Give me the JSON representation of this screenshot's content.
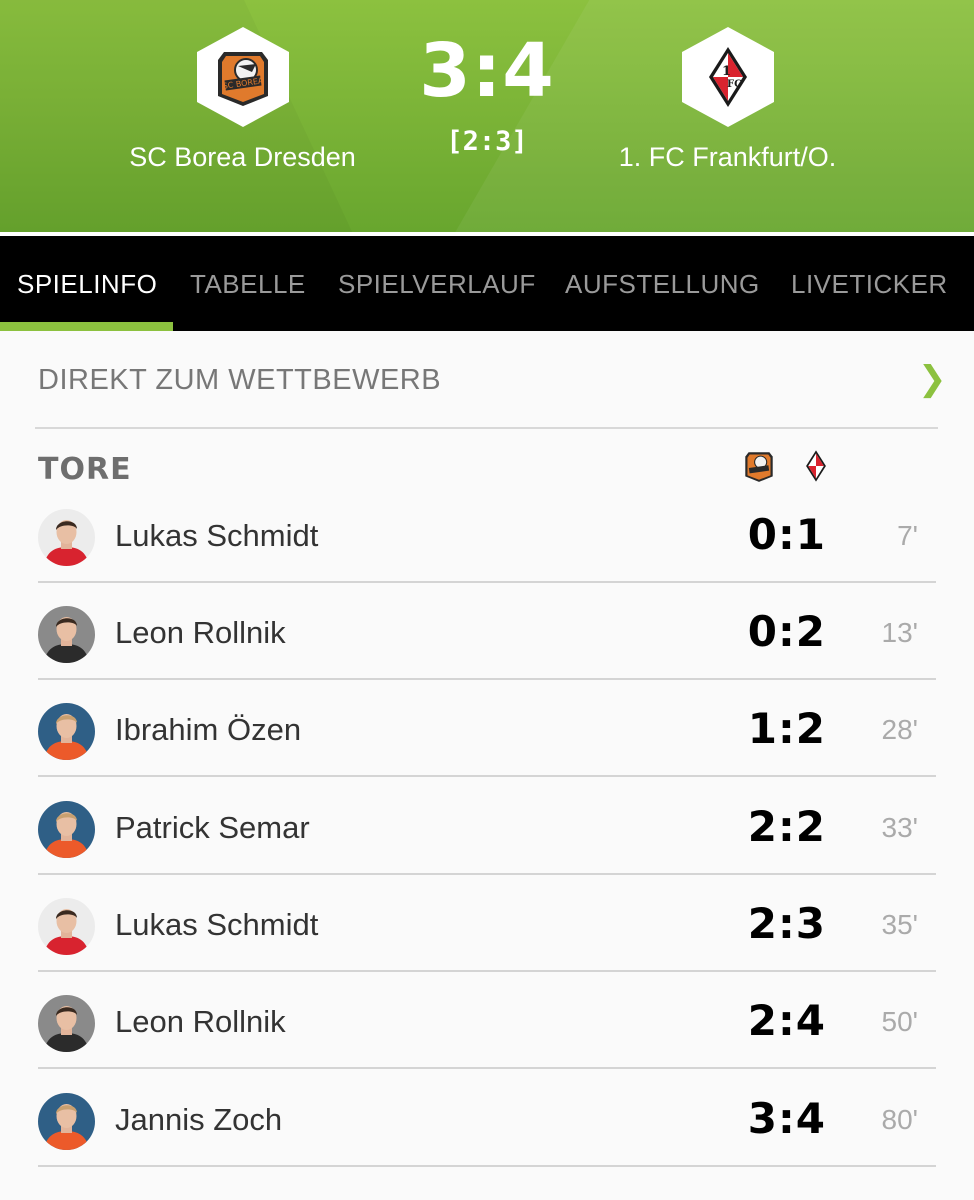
{
  "match": {
    "home_team": "SC Borea Dresden",
    "away_team": "1. FC Frankfurt/O.",
    "score": "3:4",
    "halftime": "[2:3]",
    "home_logo_icon": "sc-borea-crest-icon",
    "away_logo_icon": "fc-frankfurt-crest-icon",
    "colors": {
      "header_green": "#79b236",
      "accent_green": "#8cc13f"
    }
  },
  "tabs": [
    {
      "label": "SPIELINFO",
      "active": true
    },
    {
      "label": "TABELLE",
      "active": false
    },
    {
      "label": "SPIELVERLAUF",
      "active": false
    },
    {
      "label": "AUFSTELLUNG",
      "active": false
    },
    {
      "label": "LIVETICKER",
      "active": false
    }
  ],
  "competition_link": {
    "label": "DIREKT ZUM WETTBEWERB",
    "chevron_icon": "chevron-right-icon"
  },
  "goals_section": {
    "title": "TORE",
    "goals": [
      {
        "player": "Lukas Schmidt",
        "score": "0:1",
        "minute": "7'",
        "team": "away",
        "jersey": "red"
      },
      {
        "player": "Leon Rollnik",
        "score": "0:2",
        "minute": "13'",
        "team": "away",
        "jersey": "dark"
      },
      {
        "player": "Ibrahim Özen",
        "score": "1:2",
        "minute": "28'",
        "team": "home",
        "jersey": "orange"
      },
      {
        "player": "Patrick Semar",
        "score": "2:2",
        "minute": "33'",
        "team": "home",
        "jersey": "orange"
      },
      {
        "player": "Lukas Schmidt",
        "score": "2:3",
        "minute": "35'",
        "team": "away",
        "jersey": "red"
      },
      {
        "player": "Leon Rollnik",
        "score": "2:4",
        "minute": "50'",
        "team": "away",
        "jersey": "dark"
      },
      {
        "player": "Jannis Zoch",
        "score": "3:4",
        "minute": "80'",
        "team": "home",
        "jersey": "orange"
      }
    ]
  }
}
